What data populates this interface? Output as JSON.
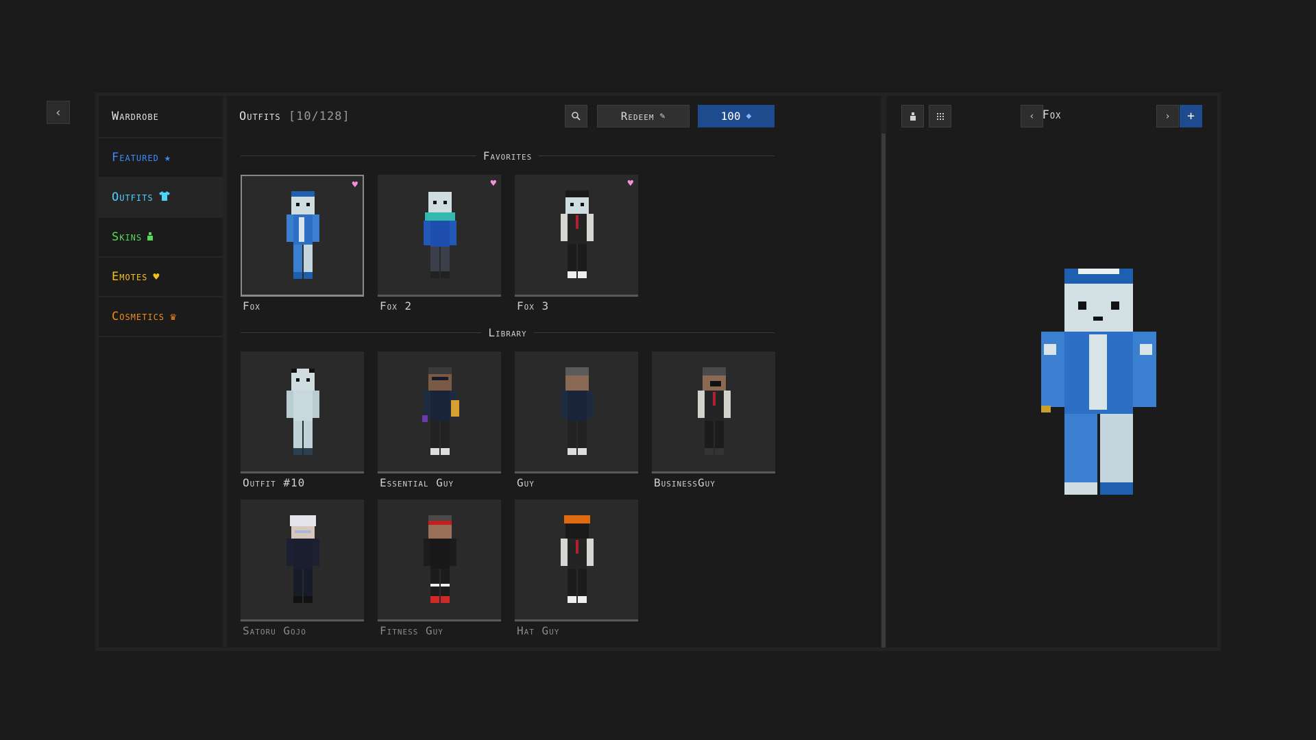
{
  "nav": {
    "title": "Wardrobe",
    "items": [
      {
        "label": "Featured",
        "icon": "★",
        "color": "#3b8cff"
      },
      {
        "label": "Outfits",
        "icon": "👕",
        "color": "#4fd0ff"
      },
      {
        "label": "Skins",
        "icon": "♟",
        "color": "#57d957"
      },
      {
        "label": "Emotes",
        "icon": "♥",
        "color": "#f2c21b"
      },
      {
        "label": "Cosmetics",
        "icon": "♛",
        "color": "#f28c1b"
      }
    ]
  },
  "outfits": {
    "title": "Outfits",
    "count": "[10/128]",
    "redeem_label": "Redeem",
    "coins": "100"
  },
  "sections": {
    "favorites": "Favorites",
    "library": "Library"
  },
  "favorites": [
    {
      "name": "Fox",
      "favorited": true
    },
    {
      "name": "Fox 2",
      "favorited": true
    },
    {
      "name": "Fox 3",
      "favorited": true
    }
  ],
  "library": [
    {
      "name": "Outfit #10"
    },
    {
      "name": "Essential Guy"
    },
    {
      "name": "Guy"
    },
    {
      "name": "BusinessGuy"
    },
    {
      "name": "Satoru Gojo"
    },
    {
      "name": "Fitness Guy"
    },
    {
      "name": "Hat Guy"
    }
  ],
  "preview": {
    "title": "Fox"
  },
  "colors": {
    "accent_blue": "#1e4a8e",
    "heart_pink": "#f58fd8"
  }
}
